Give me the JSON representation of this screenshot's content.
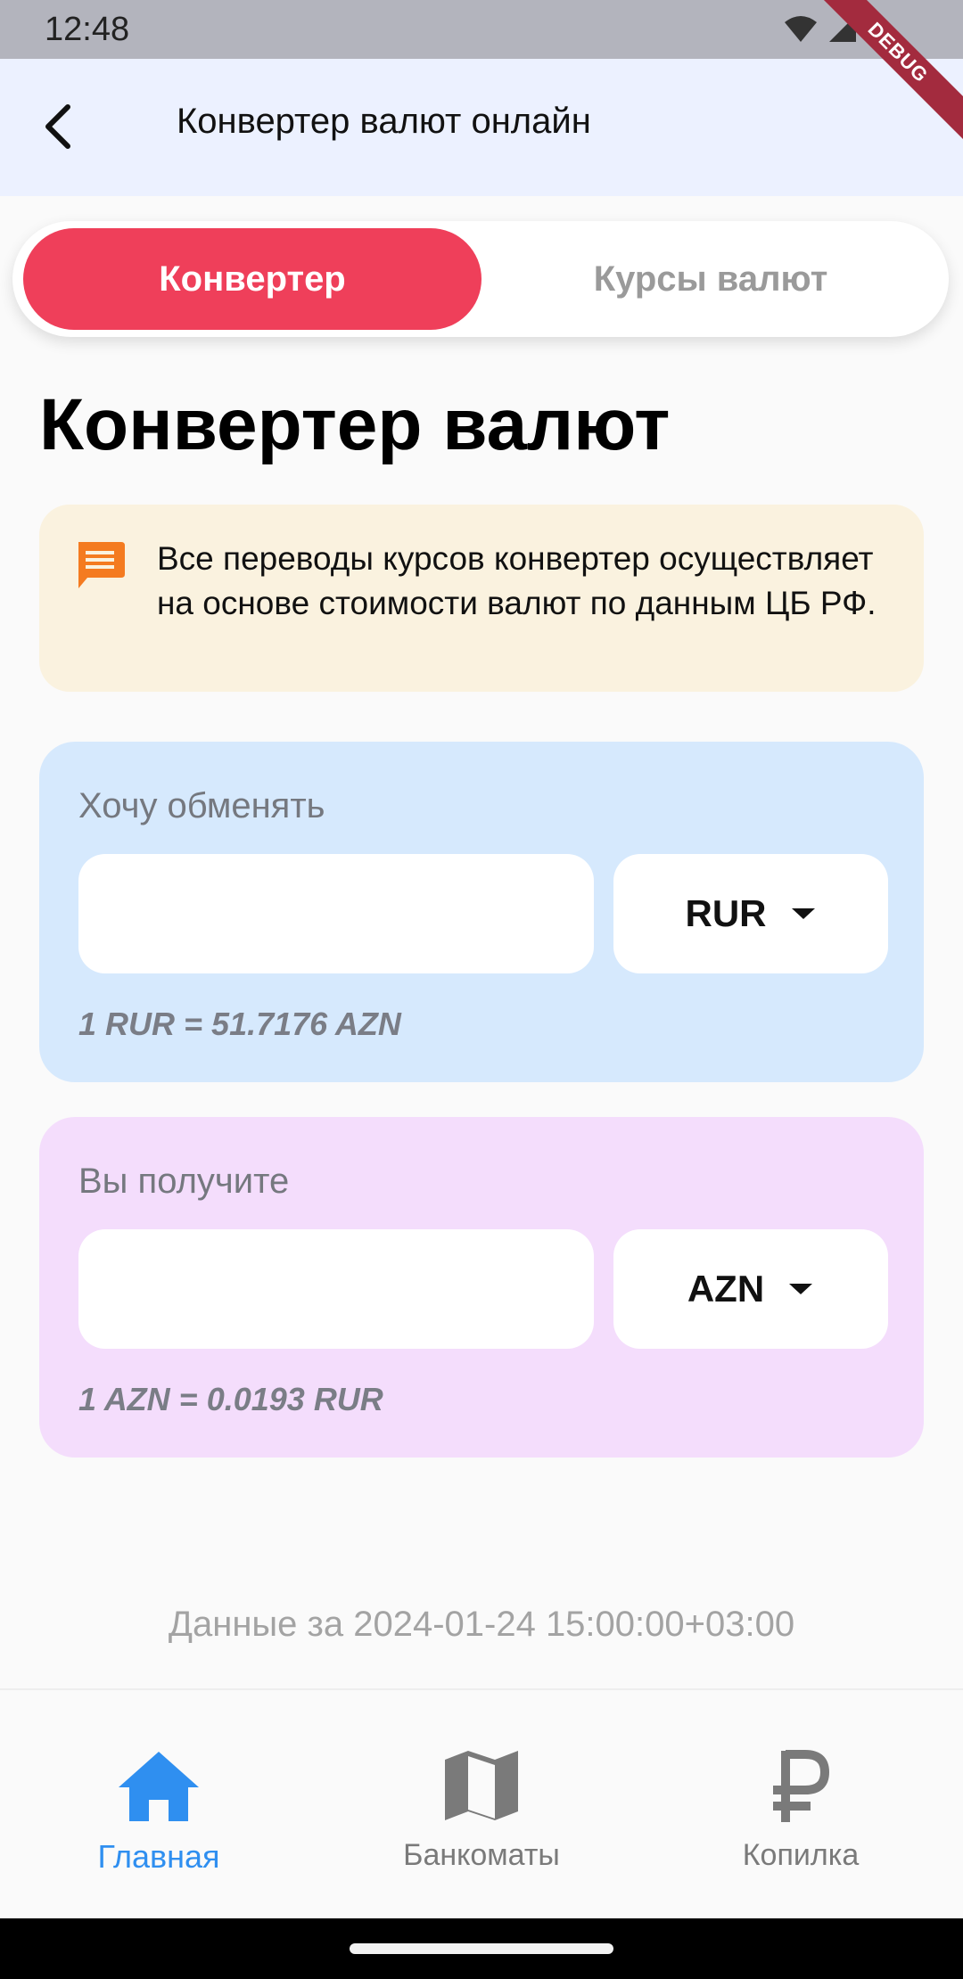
{
  "status_bar": {
    "time": "12:48",
    "icons": [
      "wifi-icon",
      "cell-signal-icon",
      "battery-icon"
    ],
    "debug_label": "DEBUG"
  },
  "app_bar": {
    "title": "Конвертер валют онлайн",
    "back_icon": "back-arrow-icon"
  },
  "tabs": [
    {
      "label": "Конвертер",
      "active": true
    },
    {
      "label": "Курсы валют",
      "active": false
    }
  ],
  "page_title": "Конвертер валют",
  "info": {
    "icon": "message-icon",
    "text": "Все переводы курсов конвертер осуществляет на основе стоимости валют по данным ЦБ РФ."
  },
  "exchange_from": {
    "label": "Хочу обменять",
    "amount": "",
    "currency": "RUR",
    "rate": "1 RUR = 51.7176 AZN"
  },
  "exchange_to": {
    "label": "Вы получите",
    "amount": "",
    "currency": "AZN",
    "rate": "1 AZN = 0.0193 RUR"
  },
  "data_date": "Данные за 2024-01-24 15:00:00+03:00",
  "bottom_nav": [
    {
      "label": "Главная",
      "icon": "home-icon",
      "active": true
    },
    {
      "label": "Банкоматы",
      "icon": "map-icon",
      "active": false
    },
    {
      "label": "Копилка",
      "icon": "ruble-icon",
      "active": false
    }
  ],
  "colors": {
    "accent": "#ef3f5a",
    "nav_active": "#2f8ff0",
    "app_bar_bg": "#ecf1ff",
    "info_bg": "#faf2df",
    "info_icon": "#f47b20",
    "card_from_bg": "#d6e9fd",
    "card_to_bg": "#f4ddfc"
  }
}
